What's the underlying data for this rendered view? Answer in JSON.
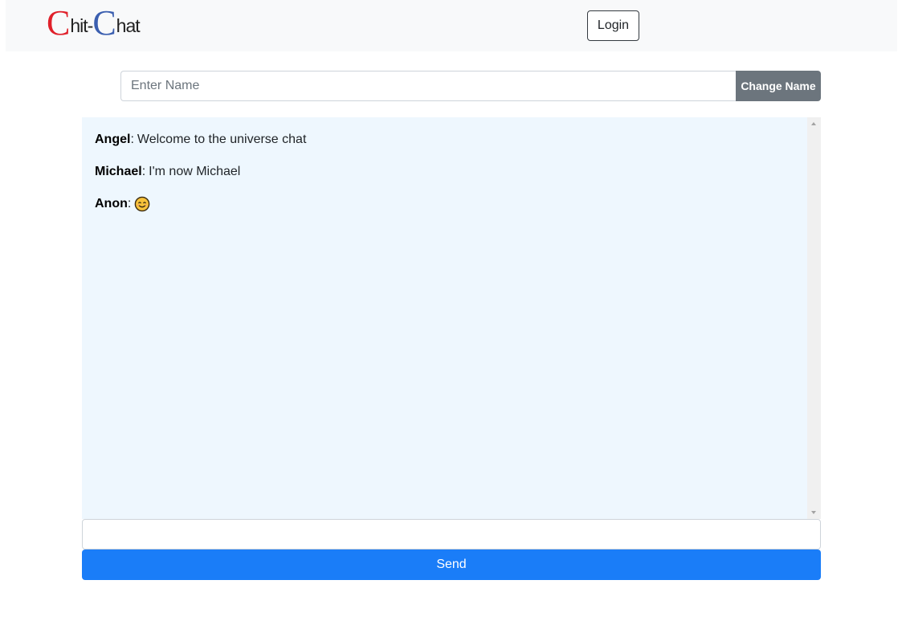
{
  "navbar": {
    "logo": {
      "first_c": "C",
      "first_text": "hit-",
      "second_c": "C",
      "second_text": "hat",
      "colors": {
        "red": "#e0202a",
        "blue": "#3b5fb0"
      }
    },
    "login_label": "Login"
  },
  "name_form": {
    "input_value": "",
    "input_placeholder": "Enter Name",
    "change_label": "Change Name"
  },
  "chat": {
    "messages": [
      {
        "author": "Angel",
        "sep": ":",
        "text": "Welcome to the universe chat"
      },
      {
        "author": "Michael",
        "sep": ":",
        "text": "I'm now Michael"
      },
      {
        "author": "Anon",
        "sep": ":",
        "text": "",
        "emoji": "smiling-face-icon"
      }
    ]
  },
  "composer": {
    "input_value": "",
    "send_label": "Send"
  },
  "colors": {
    "navbar_bg": "#f8f9fa",
    "chat_bg": "#eef7fe",
    "primary": "#1a7df8",
    "secondary": "#6c757d"
  }
}
